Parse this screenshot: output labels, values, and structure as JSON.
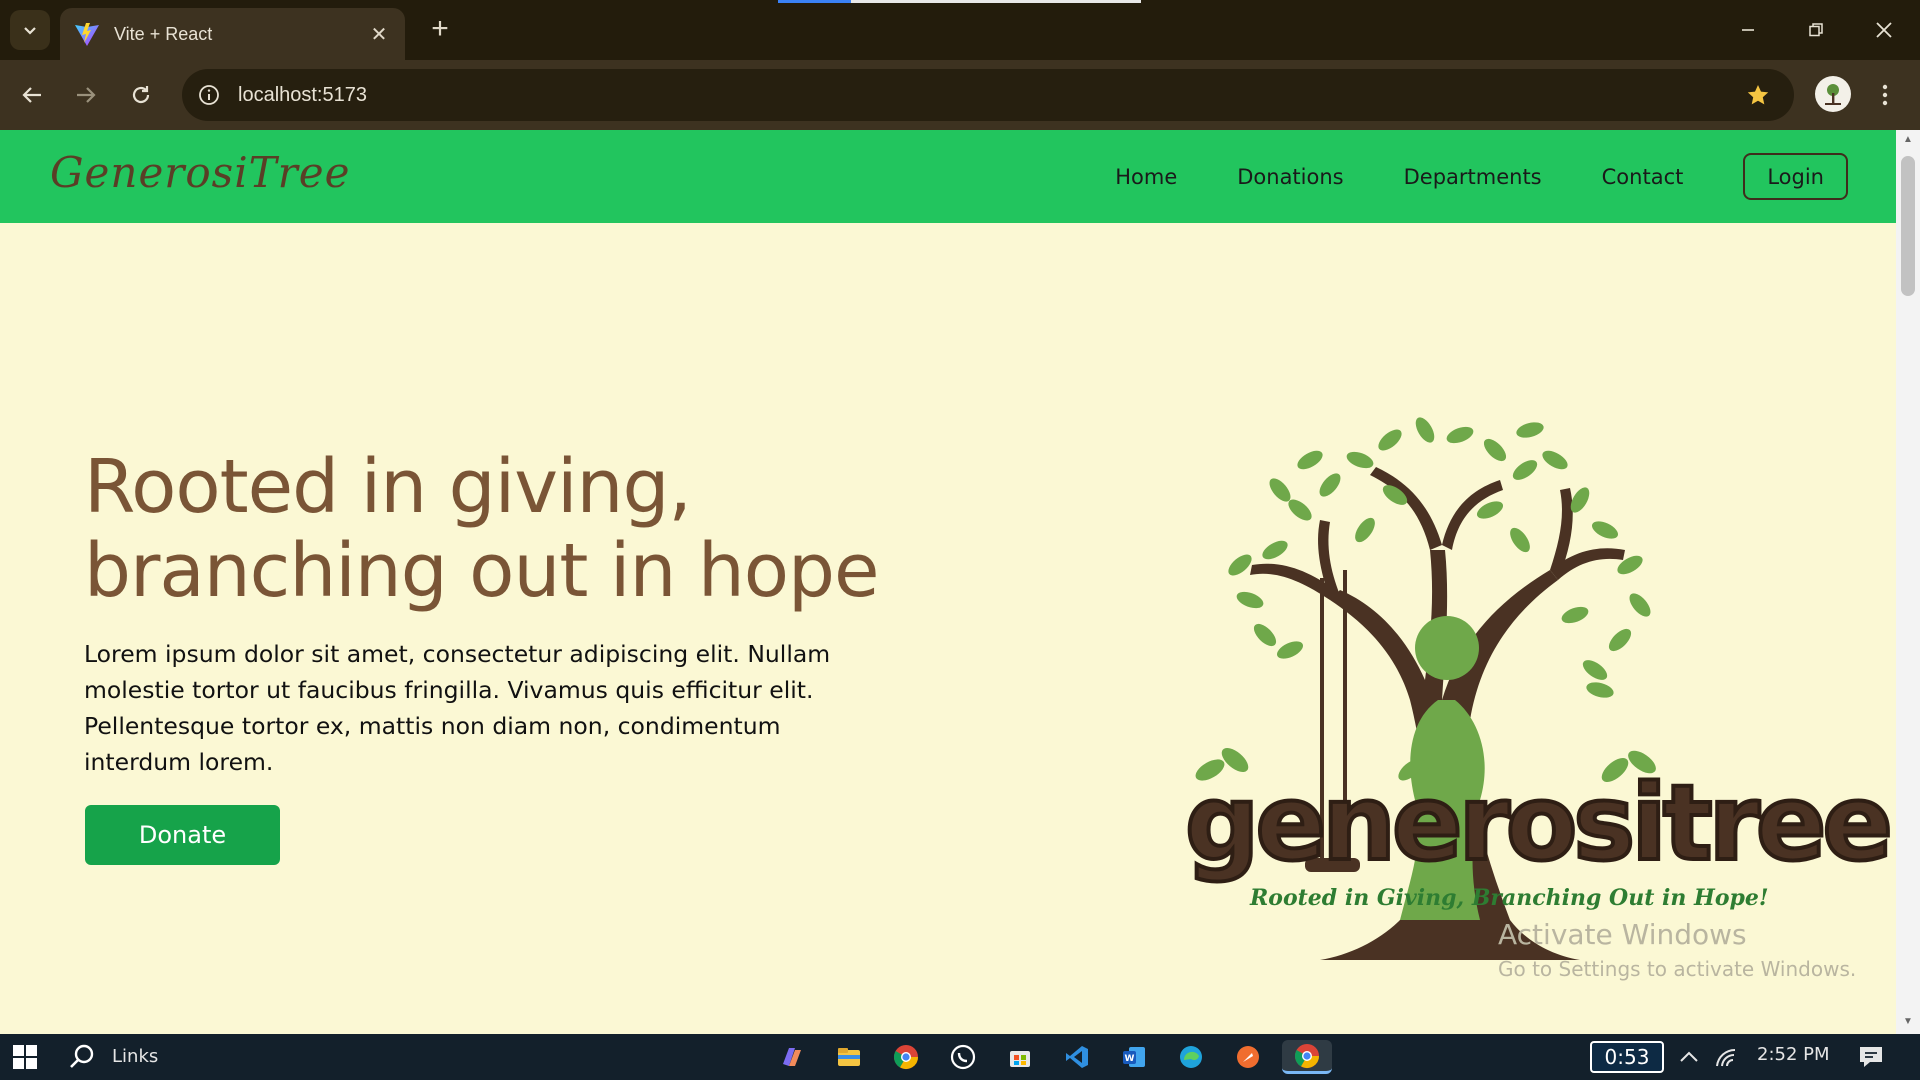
{
  "browser": {
    "tab": {
      "title": "Vite + React"
    },
    "new_tab_label": "+",
    "address": {
      "url": "localhost:5173"
    }
  },
  "page": {
    "navbar": {
      "brand": "GenerosiTree",
      "links": [
        "Home",
        "Donations",
        "Departments",
        "Contact"
      ],
      "login_label": "Login"
    },
    "hero": {
      "title_line1": "Rooted in giving,",
      "title_line2": "branching out in hope",
      "body": "Lorem ipsum dolor sit amet, consectetur adipiscing elit. Nullam molestie tortor ut faucibus fringilla. Vivamus quis efficitur elit. Pellentesque tortor ex, mattis non diam non, condimentum interdum lorem.",
      "donate_label": "Donate"
    },
    "logo": {
      "wordmark": "generositree",
      "tagline": "Rooted in Giving, Branching Out in Hope!"
    }
  },
  "watermark": {
    "title": "Activate Windows",
    "subtitle": "Go to Settings to activate Windows."
  },
  "taskbar": {
    "search_label": "Links",
    "timer": "0:53",
    "clock": "2:52 PM",
    "apps": [
      "copilot-icon",
      "file-explorer-icon",
      "chrome-icon",
      "whatsapp-icon",
      "store-icon",
      "vscode-icon",
      "word-icon",
      "edge-icon",
      "postman-icon",
      "chrome-active-icon"
    ]
  },
  "colors": {
    "navbar": "#22c55e",
    "page_bg": "#fbf8d4",
    "title_brown": "#7a5536",
    "donate_green": "#16a34a"
  }
}
